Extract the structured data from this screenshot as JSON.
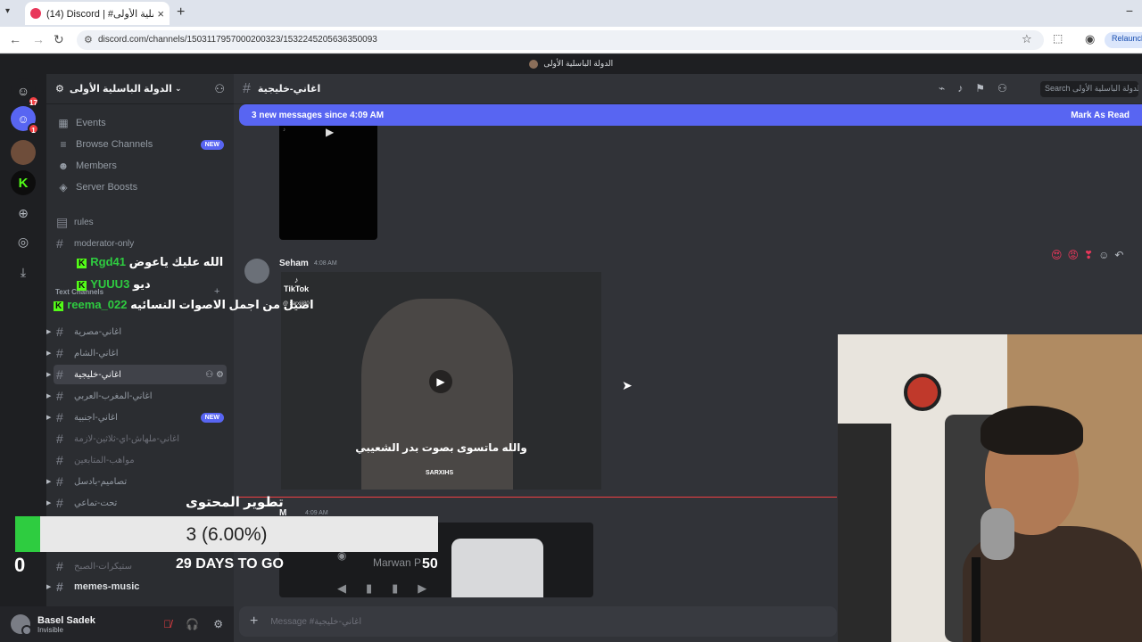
{
  "browser": {
    "tab_title": "(14) Discord | #اغاني-خليجية | الدولة الباسلية الأولى",
    "url": "discord.com/channels/1503117957000200323/1532245205636350093",
    "relaunch_label": "Relaunch"
  },
  "discord": {
    "window_title": "الدولة الباسلية الأولى",
    "rail": {
      "home_badge": "17",
      "server_badge": "1"
    },
    "server_name": "الدولة الباسلية الأولى",
    "nav": [
      {
        "label": "Events",
        "icon": "calendar-icon"
      },
      {
        "label": "Browse Channels",
        "icon": "list-icon",
        "badge": "NEW"
      },
      {
        "label": "Members",
        "icon": "members-icon"
      },
      {
        "label": "Server Boosts",
        "icon": "boost-icon"
      }
    ],
    "channels_top": [
      "rules",
      "moderator-only"
    ],
    "category_label": "Text Channels",
    "channels": [
      {
        "name": "اغاني-مصرية"
      },
      {
        "name": "اغاني-الشام"
      },
      {
        "name": "اغاني-خليجية"
      },
      {
        "name": "اغاني-المغرب-العربي"
      },
      {
        "name": "اغاني-اجنبية",
        "badge": "NEW"
      },
      {
        "name": "اغاني-ملهاش-اي-ثلاثين-لازمة"
      },
      {
        "name": "مواهب-المتابعين"
      },
      {
        "name": "تصاميم-بادسل"
      },
      {
        "name": "تحت-تماعي"
      },
      {
        "name": "ستيكرات-الصبح"
      },
      {
        "name": "memes-music"
      }
    ],
    "user": {
      "name": "Basel Sadek",
      "status": "Invisible"
    },
    "chat": {
      "channel_name": "اغاني-خليجية",
      "search_placeholder": "Search الدولة الباسلية الأولى",
      "new_messages": "3 new messages since 4:09 AM",
      "mark_as_read": "Mark As Read",
      "messages": [
        {
          "author": "Seham",
          "time": "4:08 AM",
          "embed_brand": "TikTok",
          "embed_handle": "@ sarxiii80",
          "subtitle": "والله ماتسوى بصوت بدر الشعيبي",
          "watermark": "SARXIHS"
        },
        {
          "author": "M",
          "time": "4:09 AM",
          "card_artist": "Marwan P"
        }
      ],
      "composer_placeholder": "Message #اغاني-خليجية"
    }
  },
  "overlay": {
    "chat": [
      {
        "user": "Rgd41",
        "text": "الله عليك ياعوض"
      },
      {
        "user": "YUUU3",
        "text": "ديو"
      },
      {
        "user": "reema_022",
        "text": "اصيل من اجمل الاصوات النسائيه"
      }
    ],
    "goal": {
      "title": "تطوير المحتوى",
      "label": "3 (6.00%)",
      "progress": 0.06,
      "start": "0",
      "days_left": "29 DAYS TO GO",
      "target": "50"
    }
  },
  "colors": {
    "accent": "#5865f2",
    "goal_fill": "#2ecc40",
    "unread": "#f23f43"
  }
}
